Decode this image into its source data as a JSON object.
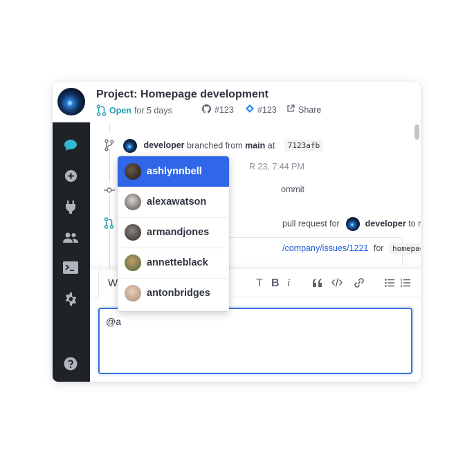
{
  "header": {
    "title": "Project: Homepage development",
    "status": "Open",
    "duration": "for 5 days",
    "github_ref": "#123",
    "jira_ref": "#123",
    "share_label": "Share"
  },
  "sidebar": {
    "items": [
      "chat-icon",
      "add-icon",
      "plug-icon",
      "users-icon",
      "terminal-icon",
      "gear-icon",
      "help-icon"
    ]
  },
  "timeline": {
    "branch_event": {
      "user": "developer",
      "action": "branched from",
      "branch": "main",
      "preposition": "at",
      "commit": "7123afb",
      "timestamp_partial": "R 23, 7:44 PM"
    },
    "commit_event": {
      "text_partial": "ommit"
    },
    "review_event": {
      "text_partial": "pull request for",
      "user": "developer",
      "suffix": "to review:"
    },
    "issue_event": {
      "link_partial": "/company/issues/1221",
      "for_label": "for",
      "branch": "homepage",
      "exclaim": "!"
    }
  },
  "editor": {
    "tab_label": "W",
    "tools": [
      "T",
      "B",
      "i",
      "quote-icon",
      "code-icon",
      "link-icon",
      "bullet-list-icon",
      "numbered-list-icon"
    ],
    "input_value": "@a"
  },
  "mention_list": {
    "items": [
      {
        "name": "ashlynnbell",
        "active": true
      },
      {
        "name": "alexawatson",
        "active": false
      },
      {
        "name": "armandjones",
        "active": false
      },
      {
        "name": "annetteblack",
        "active": false
      },
      {
        "name": "antonbridges",
        "active": false
      }
    ]
  },
  "colors": {
    "accent": "#2f67e8",
    "open_status": "#1fa2b5",
    "sidebar_bg": "#1f2328",
    "chat_icon": "#30b8d0"
  }
}
